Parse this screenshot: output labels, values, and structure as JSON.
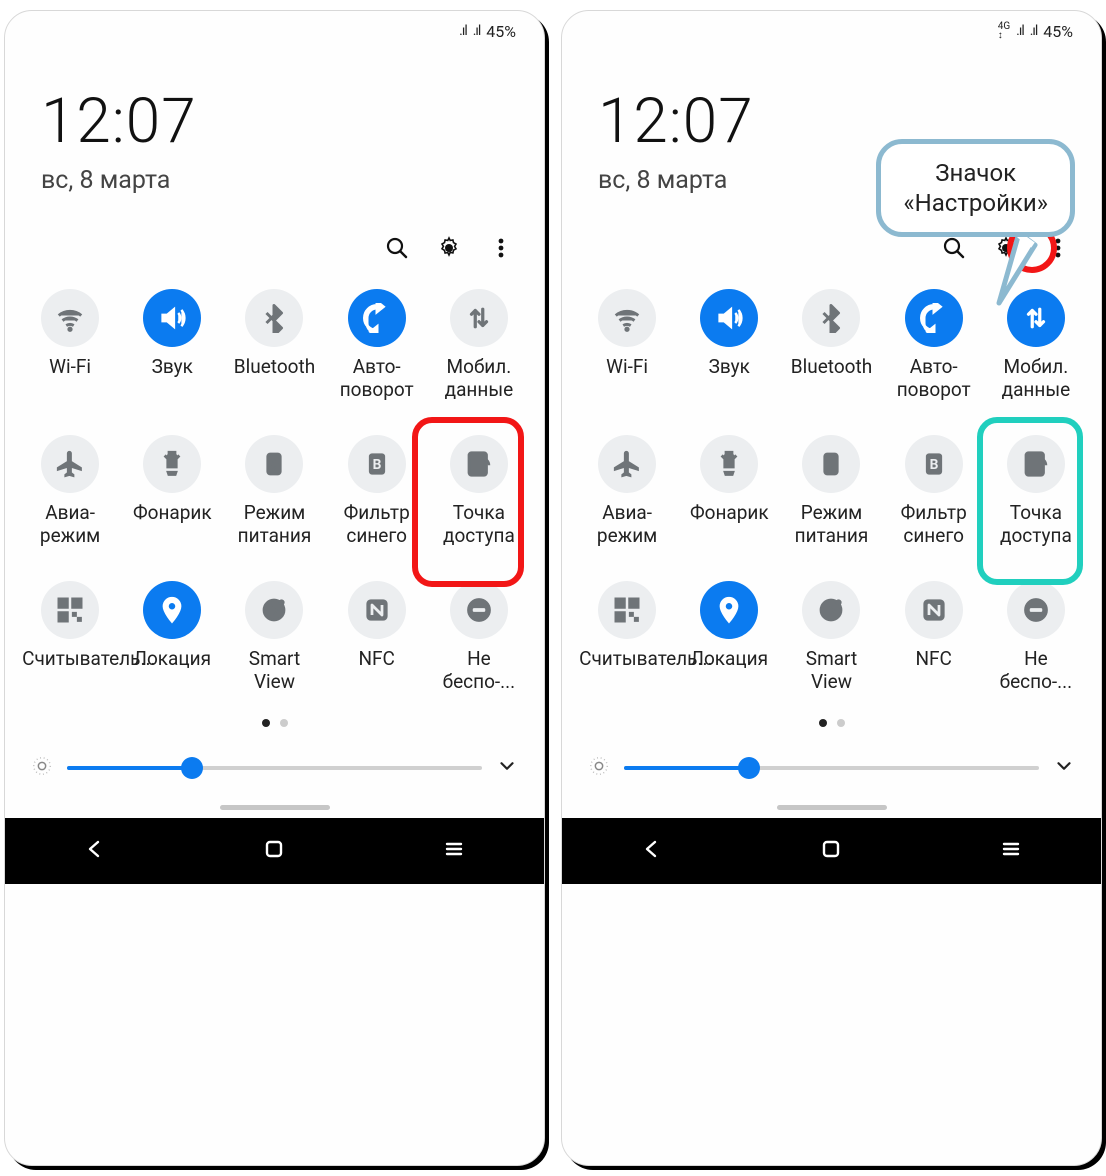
{
  "status": {
    "battery_text": "45%",
    "show_4g_left": false,
    "show_4g_right": true
  },
  "clock": {
    "time": "12:07",
    "date": "вс, 8 марта"
  },
  "tiles": {
    "wifi": "Wi-Fi",
    "sound": "Звук",
    "bluetooth": "Bluetooth",
    "rotate": "Авто-поворот",
    "data": "Мобил. данные",
    "airplane": "Авиа-режим",
    "flash": "Фонарик",
    "power": "Режим питания",
    "bluelight": "Фильтр синего",
    "hotspot": "Точка доступа",
    "qr": "Считыватель...",
    "location": "Локация",
    "smartview": "Smart View",
    "nfc": "NFC",
    "dnd": "Не беспо-..."
  },
  "brightness_pct": 30,
  "callout": {
    "line1": "Значок",
    "line2": "«Настройки»"
  },
  "states_left": {
    "wifi": false,
    "sound": true,
    "bluetooth": false,
    "rotate": true,
    "data": false,
    "airplane": false,
    "flash": false,
    "power": false,
    "bluelight": false,
    "hotspot": false,
    "qr": false,
    "location": true,
    "smartview": false,
    "nfc": false,
    "dnd": false
  },
  "states_right": {
    "wifi": false,
    "sound": true,
    "bluetooth": false,
    "rotate": true,
    "data": true,
    "airplane": false,
    "flash": false,
    "power": false,
    "bluelight": false,
    "hotspot": false,
    "qr": false,
    "location": true,
    "smartview": false,
    "nfc": false,
    "dnd": false
  }
}
